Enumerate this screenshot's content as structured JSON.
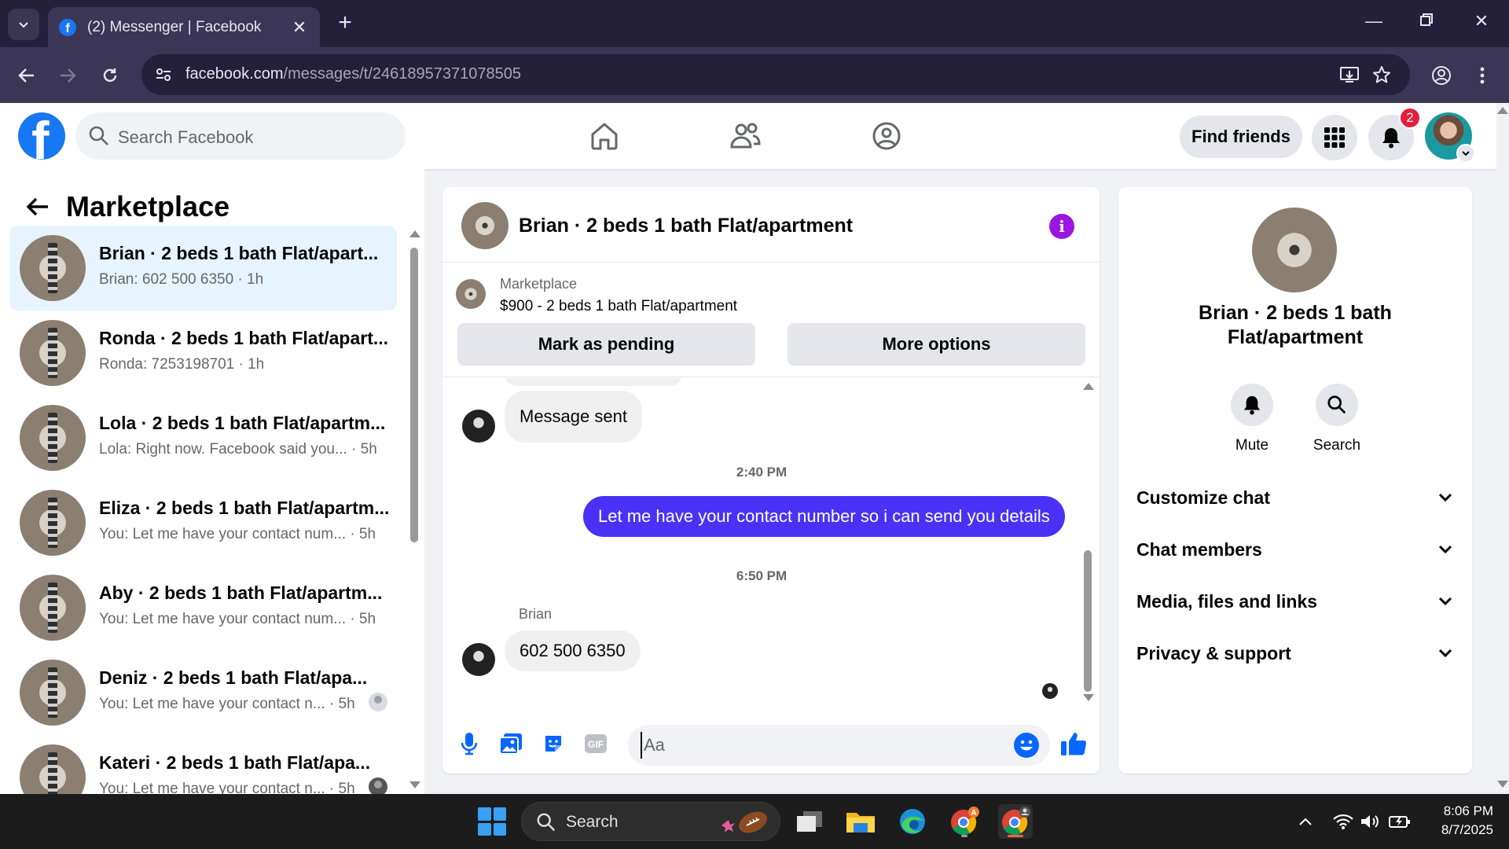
{
  "browser": {
    "tab_title": "(2) Messenger | Facebook",
    "url_domain": "facebook.com",
    "url_path": "/messages/t/24618957371078505"
  },
  "header": {
    "search_placeholder": "Search Facebook",
    "find_friends_label": "Find friends",
    "notification_count": "2"
  },
  "sidebar": {
    "title": "Marketplace",
    "conversations": [
      {
        "name": "Brian · 2 beds 1 bath Flat/apart...",
        "preview": "Brian: 602 500 6350 · 1h"
      },
      {
        "name": "Ronda · 2 beds 1 bath Flat/apart...",
        "preview": "Ronda: 7253198701 · 1h"
      },
      {
        "name": "Lola · 2 beds 1 bath Flat/apartm...",
        "preview": "Lola: Right now. Facebook said you... · 5h"
      },
      {
        "name": "Eliza · 2 beds 1 bath Flat/apartm...",
        "preview": "You: Let me have your contact num... · 5h"
      },
      {
        "name": "Aby · 2 beds 1 bath Flat/apartm...",
        "preview": "You: Let me have your contact num... · 5h"
      },
      {
        "name": "Deniz · 2 beds 1 bath Flat/apa...",
        "preview": "You: Let me have your contact n... · 5h"
      },
      {
        "name": "Kateri · 2 beds 1 bath Flat/apa...",
        "preview": "You: Let me have your contact n... · 5h"
      }
    ]
  },
  "chat": {
    "title": "Brian · 2 beds 1 bath Flat/apartment",
    "marketplace_label": "Marketplace",
    "listing": "$900 - 2 beds 1 bath Flat/apartment",
    "mark_pending_label": "Mark as pending",
    "more_options_label": "More options",
    "messages": {
      "m1": "Message sent",
      "t1": "2:40 PM",
      "m2": "Let me have your contact number so i can send you details",
      "t2": "6:50 PM",
      "sender": "Brian",
      "m3": "602 500 6350"
    },
    "composer_placeholder": "Aa"
  },
  "info_panel": {
    "name": "Brian · 2 beds 1 bath Flat/apartment",
    "mute_label": "Mute",
    "search_label": "Search",
    "sections": [
      "Customize chat",
      "Chat members",
      "Media, files and links",
      "Privacy & support"
    ]
  },
  "taskbar": {
    "search_label": "Search",
    "time": "8:06 PM",
    "date": "8/7/2025"
  },
  "colors": {
    "fb_blue": "#1877f2",
    "outgoing_bubble": "#4b31f5",
    "info_purple": "#9b16e0",
    "active_row": "#e7f3ff",
    "badge_red": "#e41e3f"
  }
}
